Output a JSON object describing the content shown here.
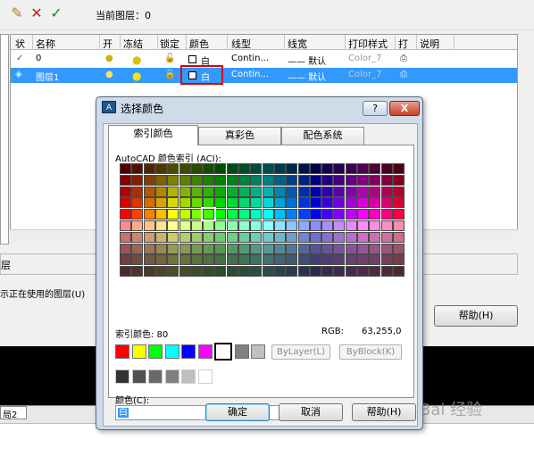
{
  "toolbar": {
    "icons": [
      "new-layer-icon",
      "delete-layer-icon",
      "set-current-icon"
    ],
    "current_layer_label": "当前图层：0"
  },
  "table": {
    "headers": [
      "状",
      "名称",
      "开",
      "冻结",
      "锁定",
      "颜色",
      "线型",
      "线宽",
      "打印样式",
      "打",
      "说明"
    ],
    "rows": [
      {
        "status": "✓",
        "name": "0",
        "color": "白",
        "linetype": "Contin...",
        "lineweight": "—— 默认",
        "plotstyle": "Color_7",
        "selected": false
      },
      {
        "status": "◈",
        "name": "图层1",
        "color": "白",
        "linetype": "Contin...",
        "lineweight": "—— 默认",
        "plotstyle": "Color_7",
        "selected": true
      }
    ]
  },
  "background": {
    "bottom_label": "层",
    "bottom_text": "示正在使用的图层(U)",
    "help_button": "帮助(H)",
    "sheet_tab": "局2"
  },
  "dialog": {
    "title": "选择颜色",
    "help_q": "?",
    "close": "X",
    "tabs": [
      "索引颜色",
      "真彩色",
      "配色系统"
    ],
    "aci_label": "AutoCAD 颜色索引 (ACI):",
    "index_label": "索引颜色: 80",
    "rgb_label": "RGB:",
    "rgb_value": "63,255,0",
    "bylayer": "ByLayer(L)",
    "byblock": "ByBlock(K)",
    "color_label": "颜色(C):",
    "color_value": "白",
    "ok": "确定",
    "cancel": "取消",
    "help": "帮助(H)"
  },
  "colors": {
    "standard": [
      "#ff0000",
      "#ffff00",
      "#00ff00",
      "#00ffff",
      "#0000ff",
      "#ff00ff",
      "#ffffff",
      "#808080",
      "#c0c0c0"
    ],
    "grays": [
      "#333333",
      "#505050",
      "#696969",
      "#808080",
      "#bebebe",
      "#ffffff"
    ]
  },
  "watermark": "Bai 经验"
}
